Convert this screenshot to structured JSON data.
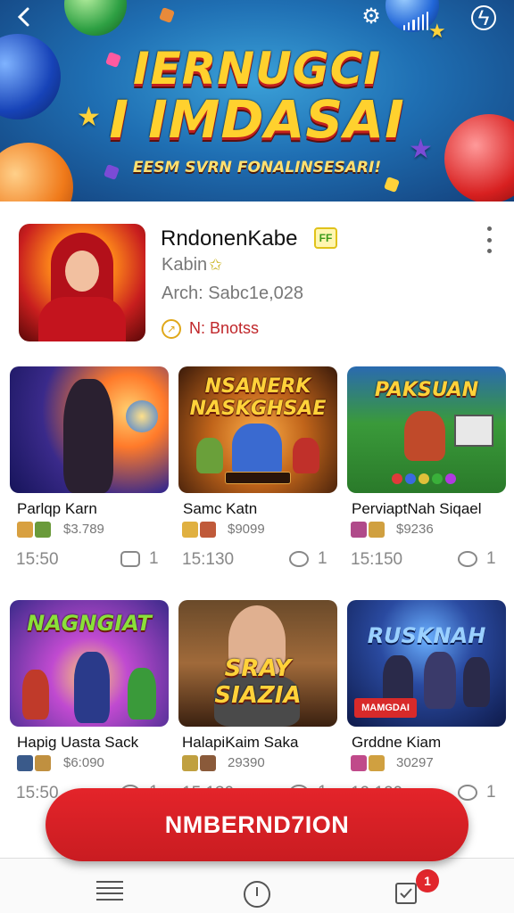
{
  "banner": {
    "title_line1": "IERNUGCI",
    "title_line2": "I IMDASAI",
    "subtitle": "EESM SVRN FONALINSESARI!"
  },
  "topbar": {
    "back_icon": "back-arrow-icon",
    "settings_icon": "gear-icon",
    "signal_icon": "signal-icon",
    "charge_icon": "bolt-icon"
  },
  "profile": {
    "name": "RndonenKabe",
    "verified_label": "FF",
    "subtitle": "Kabin",
    "arch": "Arch: Sabc1e,028",
    "badge_label": "N: Bnotss"
  },
  "games": [
    {
      "title": "Parlqp Karn",
      "price": "$3.789",
      "time": "15:50",
      "comments": "1",
      "thumb_title": ""
    },
    {
      "title": "Samc Katn",
      "price": "$9099",
      "time": "15:130",
      "comments": "1",
      "thumb_title": "NSANERK NASKGHSAE"
    },
    {
      "title": "PerviaptNah Siqael",
      "price": "$9236",
      "time": "15:150",
      "comments": "1",
      "thumb_title": "PAKSUAN"
    },
    {
      "title": "Hapig Uasta Sack",
      "price": "$6:090",
      "time": "15:50",
      "comments": "1",
      "thumb_title": "NAGNGIAT"
    },
    {
      "title": "HalapiKaim Saka",
      "price": "29390",
      "time": "15:130",
      "comments": "1",
      "thumb_title": "SRAY SIAZIA"
    },
    {
      "title": "Grddne Kiam",
      "price": "30297",
      "time": "19:120",
      "comments": "1",
      "thumb_title": "RUSKNAH"
    }
  ],
  "cta": {
    "label": "NMBERND7ION"
  },
  "bottom_nav": {
    "items": [
      {
        "icon": "menu-icon"
      },
      {
        "icon": "clock-icon"
      },
      {
        "icon": "inbox-check-icon"
      }
    ],
    "badge_count": "1"
  },
  "colors": {
    "accent": "#d81f26",
    "price_text": "#777777"
  }
}
